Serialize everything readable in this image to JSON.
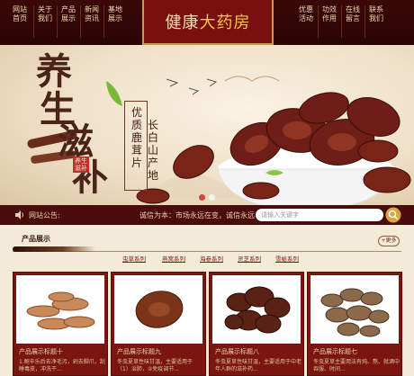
{
  "nav": {
    "left_items": [
      "网站首页",
      "关于我们",
      "产品展示",
      "新闻资讯",
      "基地展示"
    ],
    "right_items": [
      "优惠活动",
      "功效作用",
      "在线留言",
      "联系我们"
    ],
    "logo_part1": "健康",
    "logo_part2": "大药房"
  },
  "banner": {
    "char_1": "养",
    "char_2": "生",
    "char_3": "滋",
    "char_4": "补",
    "stamp": "养生滋补",
    "slogan_col1": "优质鹿茸片",
    "slogan_col2": "长白山产地",
    "slide_count": 2,
    "active_slide": 1
  },
  "notice": {
    "label": "网站公告:",
    "text": "诚信为本：市场永远在变，诚信永远",
    "search_placeholder": "请输入关键字"
  },
  "products": {
    "title": "产品展示",
    "more": "+更多",
    "categories": [
      "虫草系列",
      "燕窝系列",
      "海参系列",
      "灵芝系列",
      "雪蛤系列"
    ],
    "cards": [
      {
        "title": "产品展示标题十",
        "desc": "1.鲍辛乐后去净毛污，剁去脚爪，刮睡毒皮，冲洗干..."
      },
      {
        "title": "产品展示标题九",
        "desc": "冬虫夏草性味甘温，主要适用于（1）治肺，②免疫调节..."
      },
      {
        "title": "产品展示标题八",
        "desc": "冬虫夏草性味甘温，主要适用于中老年人群的滋补药..."
      },
      {
        "title": "产品展示标题七",
        "desc": "冬虫夏草主要用法有炖、熬、就酒中吞服、时间..."
      }
    ]
  },
  "colors": {
    "nav_bg": "#2a0504",
    "logo_bg": "#7a0f0f",
    "accent_gold": "#f7c54a",
    "card_bg": "#7a1510",
    "page_bg": "#f4ead8"
  }
}
